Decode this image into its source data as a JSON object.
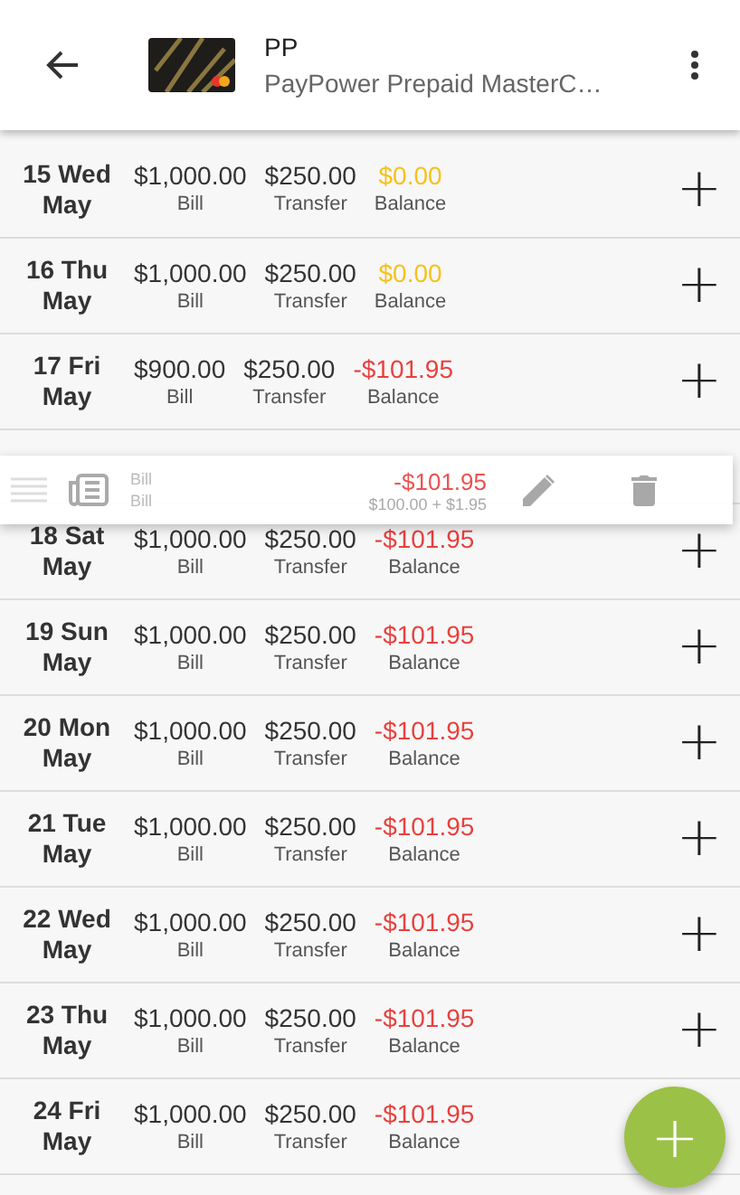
{
  "header": {
    "title": "PP",
    "subtitle": "PayPower Prepaid MasterC…"
  },
  "rows": [
    {
      "day": "15 Wed",
      "month": "May",
      "bill": "$1,000.00",
      "bill_label": "Bill",
      "transfer": "$250.00",
      "transfer_label": "Transfer",
      "balance": "$0.00",
      "balance_label": "Balance",
      "color": "#f5c21b",
      "add": "+"
    },
    {
      "day": "16 Thu",
      "month": "May",
      "bill": "$1,000.00",
      "bill_label": "Bill",
      "transfer": "$250.00",
      "transfer_label": "Transfer",
      "balance": "$0.00",
      "balance_label": "Balance",
      "color": "#f5c21b",
      "add": "+"
    },
    {
      "day": "17 Fri",
      "month": "May",
      "bill": "$900.00",
      "bill_label": "Bill",
      "transfer": "$250.00",
      "transfer_label": "Transfer",
      "balance": "-$101.95",
      "balance_label": "Balance",
      "color": "#e8413e",
      "add": "+"
    },
    {
      "kind": "gap"
    },
    {
      "day": "18 Sat",
      "month": "May",
      "bill": "$1,000.00",
      "bill_label": "Bill",
      "transfer": "$250.00",
      "transfer_label": "Transfer",
      "balance": "-$101.95",
      "balance_label": "Balance",
      "color": "#e8413e",
      "add": "+"
    },
    {
      "day": "19 Sun",
      "month": "May",
      "bill": "$1,000.00",
      "bill_label": "Bill",
      "transfer": "$250.00",
      "transfer_label": "Transfer",
      "balance": "-$101.95",
      "balance_label": "Balance",
      "color": "#e8413e",
      "add": "+"
    },
    {
      "day": "20 Mon",
      "month": "May",
      "bill": "$1,000.00",
      "bill_label": "Bill",
      "transfer": "$250.00",
      "transfer_label": "Transfer",
      "balance": "-$101.95",
      "balance_label": "Balance",
      "color": "#e8413e",
      "add": "+"
    },
    {
      "day": "21 Tue",
      "month": "May",
      "bill": "$1,000.00",
      "bill_label": "Bill",
      "transfer": "$250.00",
      "transfer_label": "Transfer",
      "balance": "-$101.95",
      "balance_label": "Balance",
      "color": "#e8413e",
      "add": "+"
    },
    {
      "day": "22 Wed",
      "month": "May",
      "bill": "$1,000.00",
      "bill_label": "Bill",
      "transfer": "$250.00",
      "transfer_label": "Transfer",
      "balance": "-$101.95",
      "balance_label": "Balance",
      "color": "#e8413e",
      "add": "+"
    },
    {
      "day": "23 Thu",
      "month": "May",
      "bill": "$1,000.00",
      "bill_label": "Bill",
      "transfer": "$250.00",
      "transfer_label": "Transfer",
      "balance": "-$101.95",
      "balance_label": "Balance",
      "color": "#e8413e",
      "add": "+"
    },
    {
      "day": "24 Fri",
      "month": "May",
      "bill": "$1,000.00",
      "bill_label": "Bill",
      "transfer": "$250.00",
      "transfer_label": "Transfer",
      "balance": "-$101.95",
      "balance_label": "Balance",
      "color": "#e8413e"
    }
  ],
  "dragged_item": {
    "category": "Bill",
    "name": "Bill",
    "amount": "-$101.95",
    "breakdown": "$100.00 + $1.95"
  },
  "fab": {
    "label": "+"
  }
}
